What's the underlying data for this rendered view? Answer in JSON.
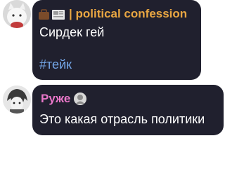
{
  "messages": [
    {
      "sender": "| political confession",
      "sender_color": "#e8a642",
      "avatar": "white-cat-avatar",
      "badge": "briefcase-newspaper-emoji",
      "text": "Сирдек гей",
      "hashtag": "#тейк"
    },
    {
      "sender": "Руже",
      "sender_color": "#e977c9",
      "avatar": "anime-character-avatar",
      "badge": "portrait-sticker",
      "text": "Это какая отрасль политики"
    }
  ],
  "colors": {
    "bubble_bg": "#20202e",
    "text": "#ffffff",
    "hashtag": "#74a7e8"
  }
}
